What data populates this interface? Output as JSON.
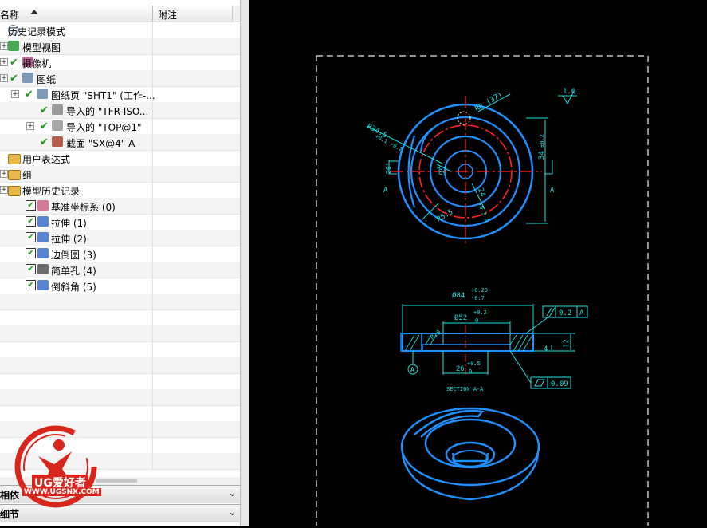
{
  "navigator": {
    "col_name": "名称",
    "col_note": "附注",
    "rows": [
      {
        "label": "历史记录模式",
        "icon": "clock-icon"
      },
      {
        "label": "模型视图",
        "icon": "model-view-icon"
      },
      {
        "label": "摄像机",
        "icon": "camera-icon"
      },
      {
        "label": "图纸",
        "icon": "drawing-icon"
      },
      {
        "label": "图纸页 \"SHT1\" (工作-...",
        "icon": "sheet-icon"
      },
      {
        "label": "导入的 \"TFR-ISO...",
        "icon": "iso-view-icon"
      },
      {
        "label": "导入的 \"TOP@1\"",
        "icon": "top-view-icon"
      },
      {
        "label": "截面 \"SX@4\" A",
        "icon": "section-view-icon"
      },
      {
        "label": "用户表达式",
        "icon": "folder-icon"
      },
      {
        "label": "组",
        "icon": "folder-icon"
      },
      {
        "label": "模型历史记录",
        "icon": "folder-icon"
      },
      {
        "label": "基准坐标系 (0)",
        "icon": "datum-csys-icon"
      },
      {
        "label": "拉伸 (1)",
        "icon": "extrude-icon"
      },
      {
        "label": "拉伸 (2)",
        "icon": "extrude-icon"
      },
      {
        "label": "边倒圆 (3)",
        "icon": "edge-blend-icon"
      },
      {
        "label": "简单孔 (4)",
        "icon": "hole-icon"
      },
      {
        "label": "倒斜角 (5)",
        "icon": "chamfer-icon"
      }
    ],
    "panel_dependencies": "相依",
    "panel_details": "细节"
  },
  "logo": {
    "brand": "UG爱好者",
    "url": "WWW.UGSNX.COM"
  },
  "drawing": {
    "dims": {
      "r345": "R34.5",
      "r345_tol": "+0.1\n-0.2",
      "r8": "R8",
      "d37": "(37)",
      "r6": "R6",
      "d24": "24",
      "d24_tol": "+0.3\n0",
      "r5": "R5.5",
      "d34": "34",
      "d34_tol": "±0.2",
      "left_small": "20°",
      "section_A_left": "A",
      "section_A_right": "A",
      "surface_finish": "1.6",
      "d84": "Ø84",
      "d84_tol_up": "+0.23",
      "d84_tol_dn": "-0.7",
      "d52": "Ø52",
      "d52_tol_up": "+0.2",
      "d52_tol_dn": "0",
      "d26": "26",
      "d26_tol_up": "+0.5",
      "d26_tol_dn": "0",
      "h4": "4",
      "h12": "12",
      "r10": "R10",
      "par_tol": "0.2",
      "par_datum": "A",
      "flat_tol": "0.09",
      "datum_A": "A",
      "section_label": "SECTION A-A"
    }
  }
}
